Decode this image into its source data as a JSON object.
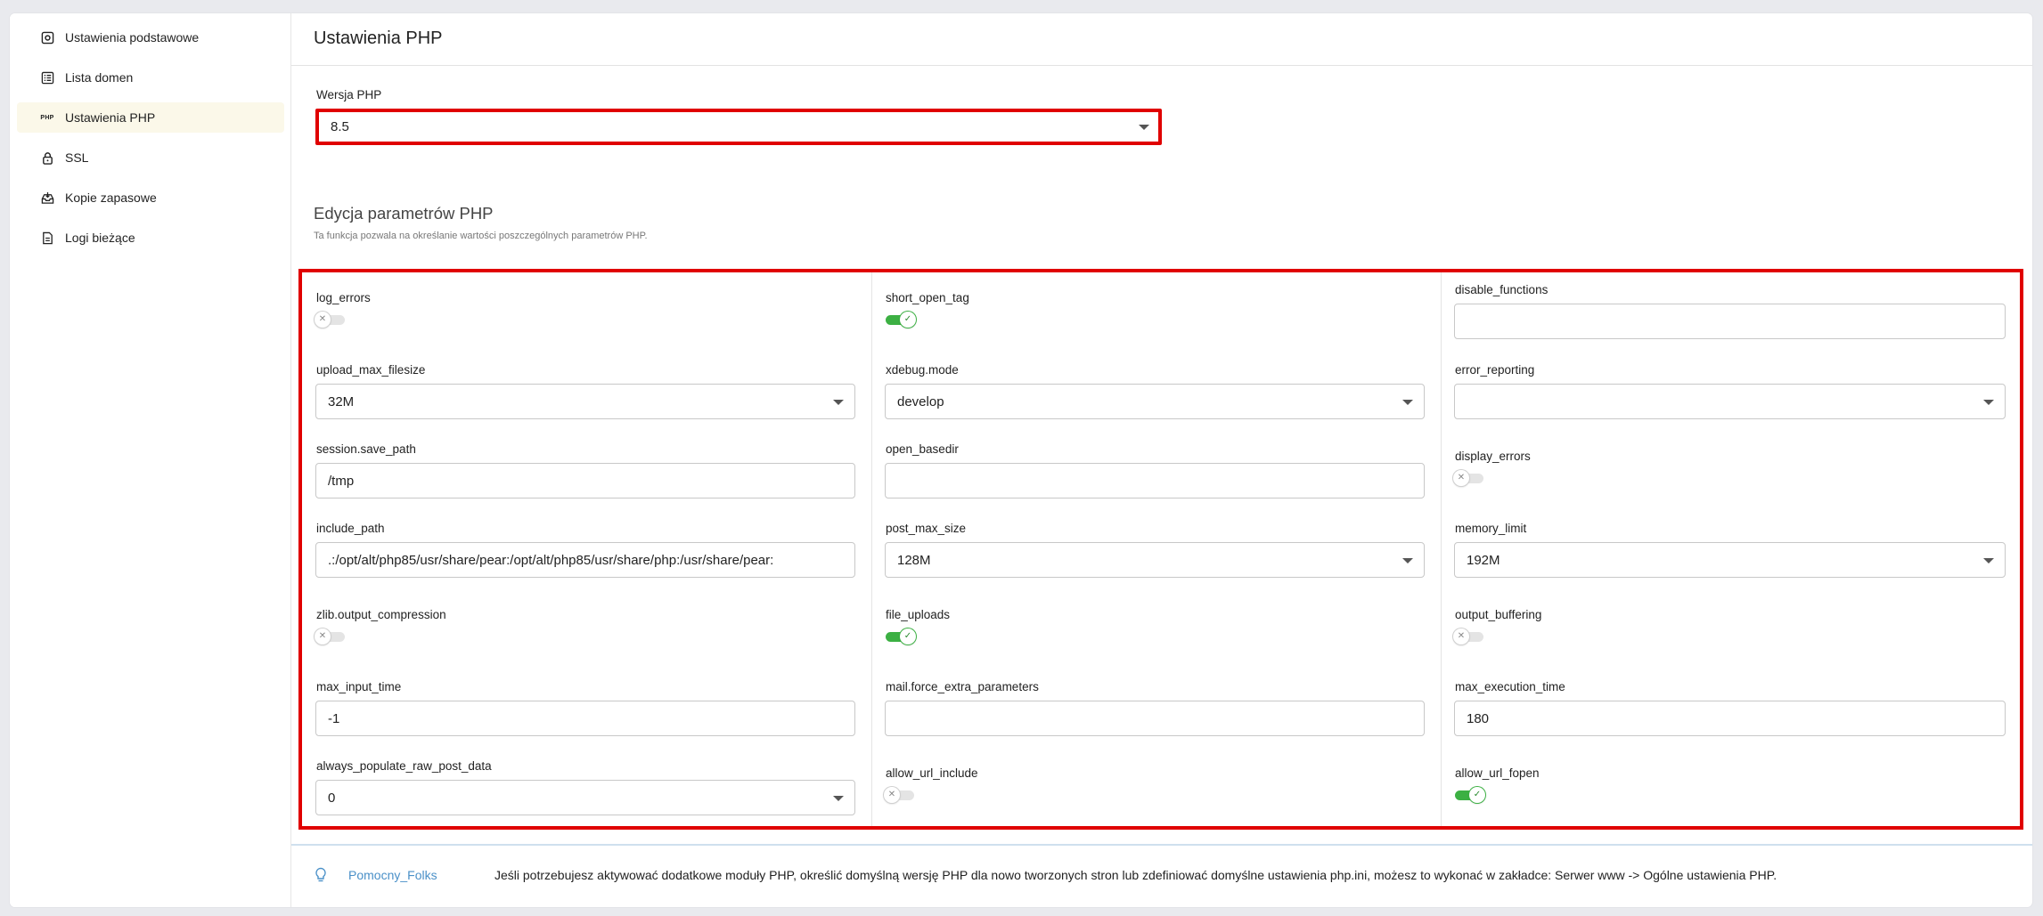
{
  "sidebar": {
    "items": [
      {
        "label": "Ustawienia podstawowe",
        "icon": "settings-square-icon"
      },
      {
        "label": "Lista domen",
        "icon": "list-icon"
      },
      {
        "label": "Ustawienia PHP",
        "icon": "php-icon",
        "icon_text": "PHP",
        "active": true
      },
      {
        "label": "SSL",
        "icon": "lock-icon"
      },
      {
        "label": "Kopie zapasowe",
        "icon": "backup-tray-icon"
      },
      {
        "label": "Logi bieżące",
        "icon": "document-icon"
      }
    ]
  },
  "page": {
    "title": "Ustawienia PHP"
  },
  "php_version": {
    "label": "Wersja PHP",
    "value": "8.5"
  },
  "params_section": {
    "title": "Edycja parametrów PHP",
    "subtitle": "Ta funkcja pozwala na określanie wartości poszczególnych parametrów PHP."
  },
  "params": {
    "col1": [
      {
        "name": "log_errors",
        "type": "toggle",
        "on": false
      },
      {
        "name": "upload_max_filesize",
        "type": "select",
        "value": "32M"
      },
      {
        "name": "session.save_path",
        "type": "input",
        "value": "/tmp"
      },
      {
        "name": "include_path",
        "type": "input",
        "value": ".:/opt/alt/php85/usr/share/pear:/opt/alt/php85/usr/share/php:/usr/share/pear:"
      },
      {
        "name": "zlib.output_compression",
        "type": "toggle",
        "on": false
      },
      {
        "name": "max_input_time",
        "type": "input",
        "value": "-1"
      },
      {
        "name": "always_populate_raw_post_data",
        "type": "select",
        "value": "0"
      }
    ],
    "col2": [
      {
        "name": "short_open_tag",
        "type": "toggle",
        "on": true
      },
      {
        "name": "xdebug.mode",
        "type": "select",
        "value": "develop"
      },
      {
        "name": "open_basedir",
        "type": "input",
        "value": ""
      },
      {
        "name": "post_max_size",
        "type": "select",
        "value": "128M"
      },
      {
        "name": "file_uploads",
        "type": "toggle",
        "on": true
      },
      {
        "name": "mail.force_extra_parameters",
        "type": "input",
        "value": ""
      },
      {
        "name": "allow_url_include",
        "type": "toggle",
        "on": false
      }
    ],
    "col3": [
      {
        "name": "disable_functions",
        "type": "input",
        "value": ""
      },
      {
        "name": "error_reporting",
        "type": "select",
        "value": ""
      },
      {
        "name": "display_errors",
        "type": "toggle",
        "on": false
      },
      {
        "name": "memory_limit",
        "type": "select",
        "value": "192M"
      },
      {
        "name": "output_buffering",
        "type": "toggle",
        "on": false
      },
      {
        "name": "max_execution_time",
        "type": "input",
        "value": "180"
      },
      {
        "name": "allow_url_fopen",
        "type": "toggle",
        "on": true
      }
    ]
  },
  "footer": {
    "helper": "Pomocny_Folks",
    "text": "Jeśli potrzebujesz aktywować dodatkowe moduły PHP, określić domyślną wersję PHP dla nowo tworzonych stron lub zdefiniować domyślne ustawienia php.ini, możesz to wykonać w zakładce: Serwer www -> Ogólne ustawienia PHP."
  },
  "colors": {
    "accent_red": "#e00000",
    "toggle_on": "#3cb043",
    "link": "#4a90c8",
    "active_bg": "#fbf8e9"
  }
}
